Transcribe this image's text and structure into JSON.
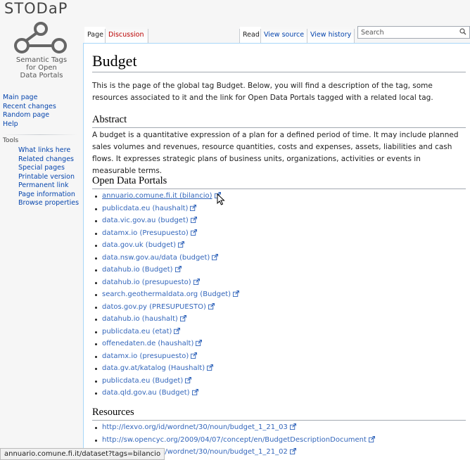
{
  "site": {
    "logo_text": "STODaP",
    "logo_subtitle": [
      "Semantic Tags",
      "for Open",
      "Data Portals"
    ]
  },
  "nav": {
    "primary": [
      "Main page",
      "Recent changes",
      "Random page",
      "Help"
    ],
    "tools_heading": "Tools",
    "tools": [
      "What links here",
      "Related changes",
      "Special pages",
      "Printable version",
      "Permanent link",
      "Page information",
      "Browse properties"
    ]
  },
  "tabs": {
    "page": "Page",
    "discussion": "Discussion",
    "read": "Read",
    "view_source": "View source",
    "view_history": "View history"
  },
  "search": {
    "placeholder": "Search"
  },
  "article": {
    "title": "Budget",
    "intro": "This is the page of the global tag Budget. Below, you will find a description of the tag, some resources associated to it and the link for Open Data Portals tagged with a related local tag.",
    "abstract_heading": "Abstract",
    "abstract_text": "A budget is a quantitative expression of a plan for a defined period of time. It may include planned sales volumes and revenues, resource quantities, costs and expenses, assets, liabilities and cash flows. It expresses strategic plans of business units, organizations, activities or events in measurable terms.",
    "portals_heading": "Open Data Portals",
    "portals": [
      "annuario.comune.fi.it (bilancio)",
      "publicdata.eu (haushalt)",
      "data.vic.gov.au (budget)",
      "datamx.io (Presupuesto)",
      "data.gov.uk (budget)",
      "data.nsw.gov.au/data (budget)",
      "datahub.io (Budget)",
      "datahub.io (presupuesto)",
      "search.geothermaldata.org (Budget)",
      "datos.gov.py (PRESUPUESTO)",
      "datahub.io (haushalt)",
      "publicdata.eu (etat)",
      "offenedaten.de (haushalt)",
      "datamx.io (presupuesto)",
      "data.gv.at/katalog (Haushalt)",
      "publicdata.eu (Budget)",
      "data.qld.gov.au (Budget)"
    ],
    "resources_heading": "Resources",
    "resources": [
      "http://lexvo.org/id/wordnet/30/noun/budget_1_21_03",
      "http://sw.opencyc.org/2009/04/07/concept/en/BudgetDescriptionDocument",
      "http://lexvo.org/id/wordnet/30/noun/budget_1_21_02"
    ]
  },
  "status_bar": {
    "url": "annuario.comune.fi.it/dataset?tags=bilancio"
  },
  "colors": {
    "link": "#3366bb",
    "new_link": "#ba0000",
    "border": "#a7d7f9"
  }
}
